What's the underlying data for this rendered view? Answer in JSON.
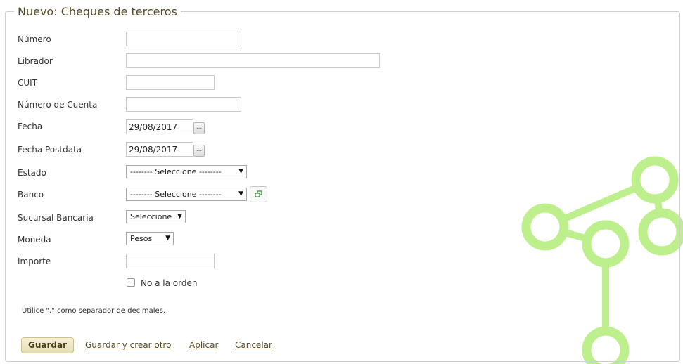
{
  "form": {
    "title": "Nuevo: Cheques de terceros",
    "fields": {
      "numero": {
        "label": "Número",
        "value": ""
      },
      "librador": {
        "label": "Librador",
        "value": ""
      },
      "cuit": {
        "label": "CUIT",
        "value": ""
      },
      "numero_cuenta": {
        "label": "Número de Cuenta",
        "value": ""
      },
      "fecha": {
        "label": "Fecha",
        "value": "29/08/2017",
        "picker_label": "..."
      },
      "fecha_postdata": {
        "label": "Fecha Postdata",
        "value": "29/08/2017",
        "picker_label": "..."
      },
      "estado": {
        "label": "Estado",
        "selected": "-------- Seleccione --------"
      },
      "banco": {
        "label": "Banco",
        "selected": "-------- Seleccione --------",
        "action_icon": "open-window-icon"
      },
      "sucursal": {
        "label": "Sucursal Bancaria",
        "selected": "Seleccione"
      },
      "moneda": {
        "label": "Moneda",
        "selected": "Pesos"
      },
      "importe": {
        "label": "Importe",
        "value": ""
      },
      "no_a_la_orden": {
        "label": "No a la orden",
        "checked": false
      }
    },
    "hint": "Utilice \",\" como separador de decimales.",
    "actions": {
      "save": "Guardar",
      "save_and_new": "Guardar y crear otro",
      "apply": "Aplicar",
      "cancel": "Cancelar"
    }
  },
  "colors": {
    "accent_green": "#bdf08d",
    "title_brown": "#5a4a25",
    "button_bg": "#efe9c6"
  }
}
